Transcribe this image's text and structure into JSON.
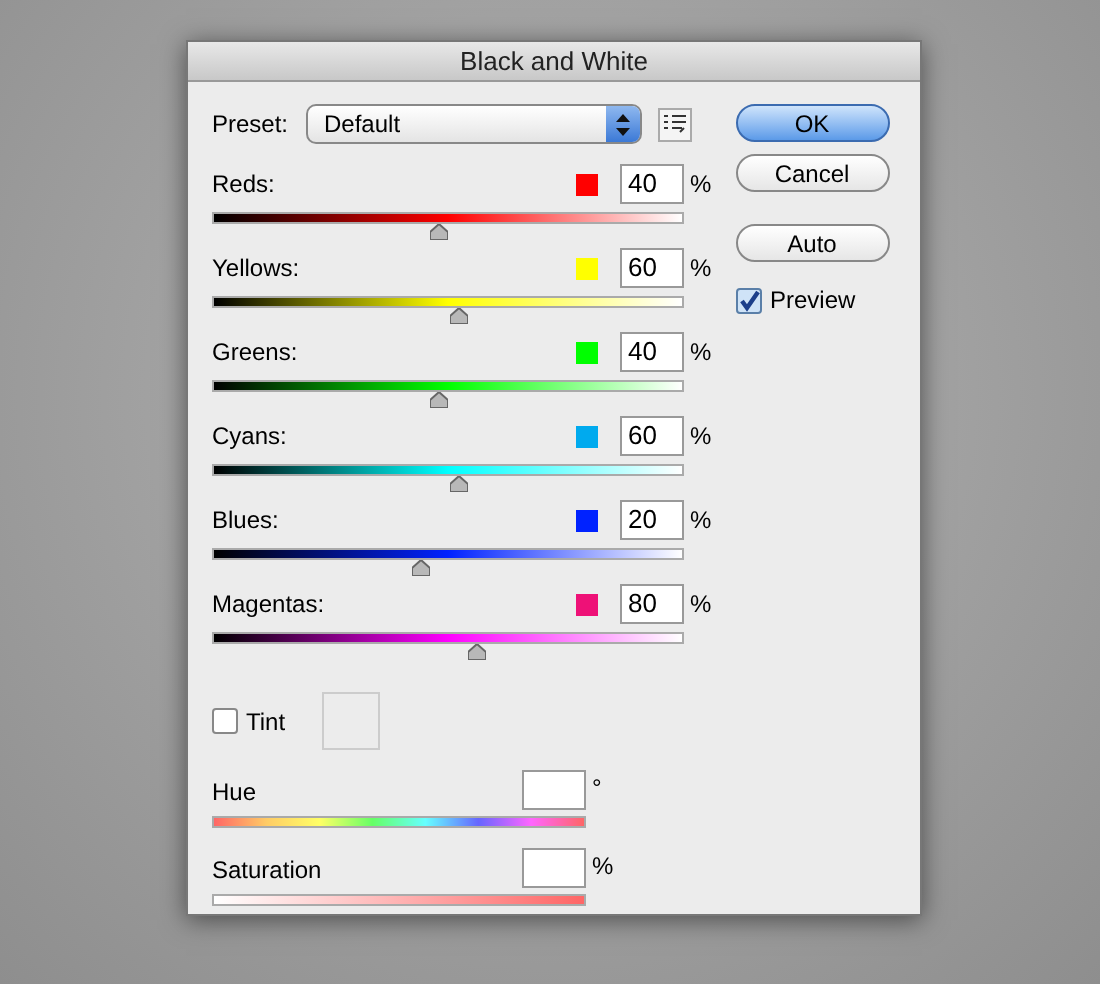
{
  "window": {
    "title": "Black and White"
  },
  "preset": {
    "label": "Preset:",
    "value": "Default"
  },
  "channels": [
    {
      "name": "Reds:",
      "color": "#ff0000",
      "value": "40",
      "unit": "%",
      "level": 0.48
    },
    {
      "name": "Yellows:",
      "color": "#ffff00",
      "value": "60",
      "unit": "%",
      "level": 0.52
    },
    {
      "name": "Greens:",
      "color": "#00ff00",
      "value": "40",
      "unit": "%",
      "level": 0.48
    },
    {
      "name": "Cyans:",
      "color": "#00aaee",
      "value": "60",
      "unit": "%",
      "level": 0.52
    },
    {
      "name": "Blues:",
      "color": "#0022ff",
      "value": "20",
      "unit": "%",
      "level": 0.44
    },
    {
      "name": "Magentas:",
      "color": "#ee1177",
      "value": "80",
      "unit": "%",
      "level": 0.56
    }
  ],
  "tint": {
    "label": "Tint",
    "checked": false
  },
  "hue": {
    "label": "Hue",
    "unit": "°"
  },
  "saturation": {
    "label": "Saturation",
    "unit": "%"
  },
  "buttons": [
    {
      "label": "OK",
      "default": true
    },
    {
      "label": "Cancel",
      "default": false
    },
    {
      "label": "Auto",
      "default": false
    }
  ],
  "preview": {
    "label": "Preview",
    "checked": true
  }
}
